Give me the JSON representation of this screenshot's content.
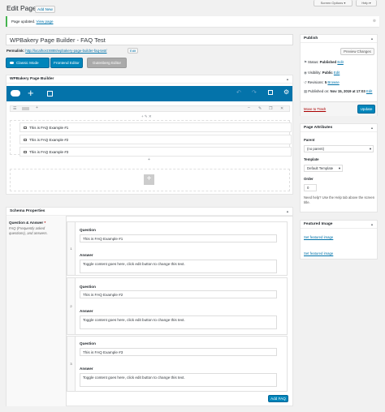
{
  "header": {
    "title": "Edit Page",
    "add_new": "Add New",
    "screen_options": "Screen Options ▾",
    "help": "Help ▾"
  },
  "notice": {
    "text": "Page updated.",
    "link": "View page"
  },
  "editor": {
    "title_value": "WPBakery Page Builder - FAQ Test",
    "permalink_label": "Permalink:",
    "permalink_url": "http://localhost:8888/wpbakery-page-builder-faq-test/",
    "permalink_edit": "Edit",
    "classic_mode": "Classic Mode",
    "frontend_editor": "Frontend Editor",
    "gutenberg_editor": "Gutenberg Editor"
  },
  "wpbakery": {
    "panel_title": "WPBakery Page Builder",
    "faq_items": [
      "This is FAQ Example #1",
      "This is FAQ Example #2",
      "This is FAQ Example #3"
    ]
  },
  "schema": {
    "panel_title": "Schema Properties",
    "field_label": "Question & Answer",
    "required_mark": "*",
    "field_desc": "FAQ (Frequently asked questions), and answers.",
    "question_label": "Question",
    "answer_label": "Answer",
    "rows": [
      {
        "num": "1",
        "question": "This is FAQ Example #1",
        "answer": "Toggle content goes here, click edit button to change this text."
      },
      {
        "num": "2",
        "question": "This is FAQ Example #2",
        "answer": "Toggle content goes here, click edit button to change this text."
      },
      {
        "num": "3",
        "question": "This is FAQ Example #3",
        "answer": "Toggle content goes here, click edit button to change this text."
      }
    ],
    "add_button": "Add FAQ"
  },
  "publish": {
    "title": "Publish",
    "preview": "Preview Changes",
    "status_label": "Status:",
    "status_value": "Published",
    "visibility_label": "Visibility:",
    "visibility_value": "Public",
    "revisions_label": "Revisions:",
    "revisions_value": "5",
    "revisions_link": "Browse",
    "published_label": "Published on:",
    "published_value": "Nov 15, 2019 at 17:03",
    "edit": "Edit",
    "trash": "Move to Trash",
    "update": "Update"
  },
  "attributes": {
    "title": "Page Attributes",
    "parent_label": "Parent",
    "parent_value": "(no parent)",
    "template_label": "Template",
    "template_value": "Default Template",
    "order_label": "Order",
    "order_value": "0",
    "help_text": "Need help? Use the Help tab above the screen title."
  },
  "featured": {
    "title": "Featured Image",
    "link1": "Set featured image",
    "link2": "Set featured image"
  },
  "colors": {
    "accent": "#0085ba",
    "wpbakery_bar": "#0473aa",
    "trash": "#a00",
    "notice_border": "#46b450"
  }
}
